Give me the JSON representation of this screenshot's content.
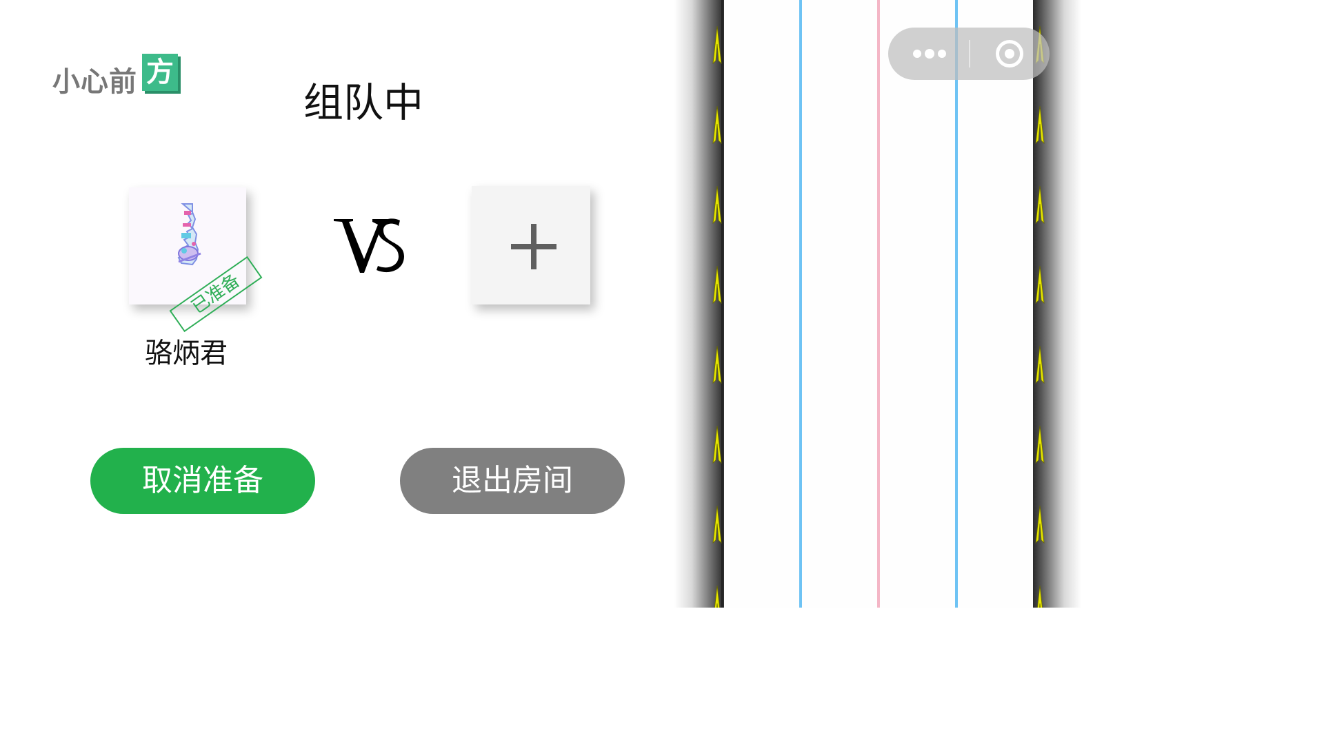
{
  "logo": {
    "text": "小心前",
    "box_char": "方"
  },
  "page": {
    "title": "组队中"
  },
  "player": {
    "name": "骆炳君",
    "status_stamp": "已准备"
  },
  "opponent_slot": {
    "icon": "plus-icon"
  },
  "vs": {
    "text": "VS"
  },
  "buttons": {
    "cancel_ready": "取消准备",
    "exit_room": "退出房间"
  },
  "colors": {
    "ready_green": "#22b14c",
    "exit_gray": "#808080",
    "logo_green": "#3dbb8a",
    "lane_blue": "#6ec3f4",
    "lane_pink": "#f4b6c6",
    "chevron_yellow": "#e6e600"
  },
  "capsule": {
    "more_icon": "more-dots-icon",
    "close_icon": "target-icon"
  }
}
